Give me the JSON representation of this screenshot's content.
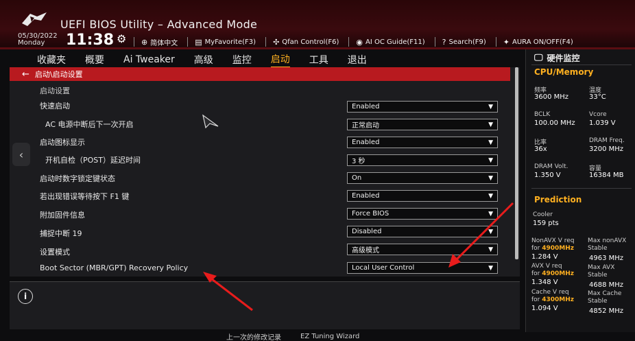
{
  "header": {
    "title": "UEFI BIOS Utility – Advanced Mode",
    "date": "05/30/2022",
    "day": "Monday",
    "time": "11:38",
    "tools": [
      {
        "icon": "globe-icon",
        "glyph": "⊕",
        "label": "简体中文"
      },
      {
        "icon": "favorite-icon",
        "glyph": "▤",
        "label": "MyFavorite(F3)"
      },
      {
        "icon": "fan-icon",
        "glyph": "✣",
        "label": "Qfan Control(F6)"
      },
      {
        "icon": "ai-oc-icon",
        "glyph": "◉",
        "label": "AI OC Guide(F11)"
      },
      {
        "icon": "search-icon",
        "glyph": "?",
        "label": "Search(F9)"
      },
      {
        "icon": "aura-icon",
        "glyph": "✦",
        "label": "AURA ON/OFF(F4)"
      }
    ]
  },
  "tabs": [
    {
      "label": "收藏夹",
      "active": false
    },
    {
      "label": "概要",
      "active": false
    },
    {
      "label": "Ai Tweaker",
      "active": false
    },
    {
      "label": "高级",
      "active": false
    },
    {
      "label": "监控",
      "active": false
    },
    {
      "label": "启动",
      "active": true
    },
    {
      "label": "工具",
      "active": false
    },
    {
      "label": "退出",
      "active": false
    }
  ],
  "breadcrumb": "启动\\启动设置",
  "section_label": "启动设置",
  "settings": [
    {
      "label": "快速启动",
      "value": "Enabled",
      "indent": false
    },
    {
      "label": "AC 电源中断后下一次开启",
      "value": "正常启动",
      "indent": true
    },
    {
      "label": "启动图标显示",
      "value": "Enabled",
      "indent": false
    },
    {
      "label": "开机自检（POST）延迟时间",
      "value": "3 秒",
      "indent": true
    },
    {
      "label": "启动时数字锁定键状态",
      "value": "On",
      "indent": false
    },
    {
      "label": "若出现错误等待按下 F1 键",
      "value": "Enabled",
      "indent": false
    },
    {
      "label": "附加固件信息",
      "value": "Force BIOS",
      "indent": false
    },
    {
      "label": "捕捉中断 19",
      "value": "Disabled",
      "indent": false
    },
    {
      "label": "设置模式",
      "value": "高级模式",
      "indent": false
    },
    {
      "label": "Boot Sector (MBR/GPT) Recovery Policy",
      "value": "Local User Control",
      "indent": false
    }
  ],
  "hw_monitor": {
    "title": "硬件监控",
    "cpu_memory": {
      "heading": "CPU/Memory",
      "items": [
        {
          "key": "频率",
          "value": "3600 MHz"
        },
        {
          "key": "温度",
          "value": "33°C"
        },
        {
          "key": "BCLK",
          "value": "100.00 MHz"
        },
        {
          "key": "Vcore",
          "value": "1.039 V"
        },
        {
          "key": "比率",
          "value": "36x"
        },
        {
          "key": "DRAM Freq.",
          "value": "3200 MHz"
        },
        {
          "key": "DRAM Volt.",
          "value": "1.350 V"
        },
        {
          "key": "容量",
          "value": "16384 MB"
        }
      ]
    },
    "prediction": {
      "heading": "Prediction",
      "cooler_key": "Cooler",
      "cooler_value": "159 pts",
      "rows": [
        {
          "left_key": "NonAVX V req",
          "left_for": "for",
          "left_freq": "4900MHz",
          "left_value": "1.284 V",
          "right_key": "Max nonAVX",
          "right_sub": "Stable",
          "right_value": "4963 MHz"
        },
        {
          "left_key": "AVX V req",
          "left_for": "for",
          "left_freq": "4900MHz",
          "left_value": "1.348 V",
          "right_key": "Max AVX",
          "right_sub": "Stable",
          "right_value": "4688 MHz"
        },
        {
          "left_key": "Cache V req",
          "left_for": "for",
          "left_freq": "4300MHz",
          "left_value": "1.094 V",
          "right_key": "Max Cache",
          "right_sub": "Stable",
          "right_value": "4852 MHz"
        }
      ]
    }
  },
  "bottom_bar": [
    "上一次的修改记录",
    "EZ Tuning Wizard"
  ],
  "colors": {
    "accent": "#ffb020",
    "crumb_red": "#b81a1f",
    "annotation_red": "#e81c1c"
  }
}
